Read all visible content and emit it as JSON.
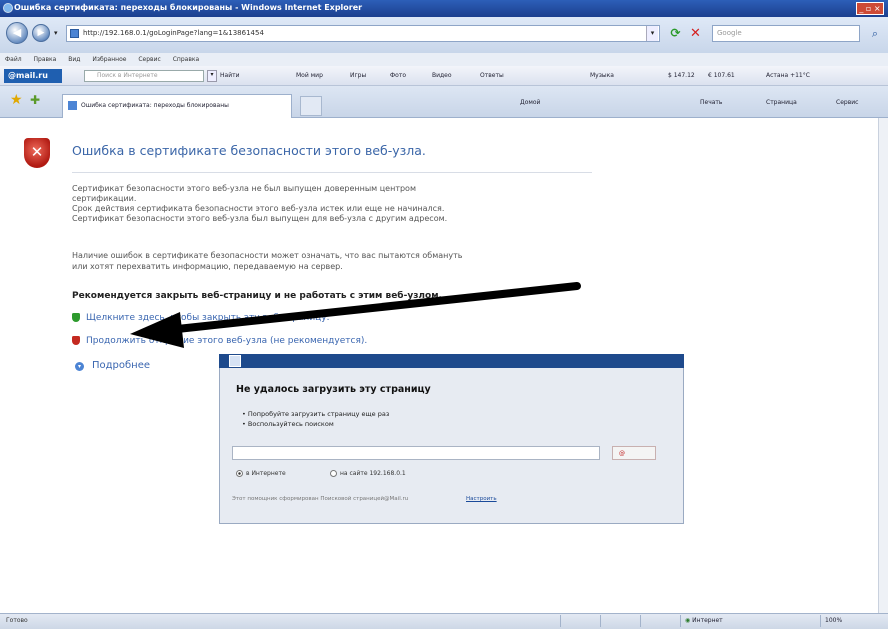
{
  "window": {
    "title": "Ошибка сертификата: переходы блокированы - Windows Internet Explorer",
    "controls": "_ ▫ ×"
  },
  "address_bar": {
    "url": "http://192.168.0.1/goLoginPage?lang=1&13861454",
    "search_placeholder": "Google",
    "back_icon": "back-arrow-icon",
    "forward_icon": "forward-arrow-icon"
  },
  "menu": {
    "items": [
      "Файл",
      "Правка",
      "Вид",
      "Избранное",
      "Сервис",
      "Справка"
    ]
  },
  "mail_toolbar": {
    "logo": "@mail.ru",
    "search_placeholder": "Поиск в Интернете",
    "items": [
      "Найти",
      "Мой мир",
      "Игры",
      "Фото",
      "Видео",
      "Ответы",
      "Музыка",
      "$ 147.12",
      "€ 107.61",
      "Астана +11°C"
    ]
  },
  "tabs": {
    "active_label": "Ошибка сертификата: переходы блокированы"
  },
  "command_bar": {
    "items": [
      "Домой",
      "Печать",
      "Страница",
      "Сервис"
    ]
  },
  "error_page": {
    "title": "Ошибка в сертификате безопасности этого веб-узла.",
    "paragraph1": [
      "Сертификат безопасности этого веб-узла не был выпущен доверенным центром",
      "сертификации.",
      "Срок действия сертификата безопасности этого веб-узла истек или еще не начинался.",
      "Сертификат безопасности этого веб-узла был выпущен для веб-узла с другим адресом."
    ],
    "paragraph2": [
      "Наличие ошибок в сертификате безопасности может означать, что вас пытаются обмануть",
      "или хотят перехватить информацию, передаваемую на сервер."
    ],
    "recommendation": "Рекомендуется закрыть веб-страницу и не работать с этим веб-узлом.",
    "link_close": "Щелкните здесь, чтобы закрыть эту веб-страницу.",
    "link_continue": "Продолжить открытие этого веб-узла (не рекомендуется).",
    "link_details": "Подробнее"
  },
  "overlay_dialog": {
    "title": "Не удалось загрузить эту страницу",
    "bullets": [
      "Попробуйте загрузить страницу еще раз",
      "Воспользуйтесь поиском"
    ],
    "search_button": "@",
    "radio_internet": "в Интернете",
    "radio_site": "на сайте 192.168.0.1",
    "footer_text": "Этот помощник сформирован Поисковой страницей@Mail.ru",
    "footer_link": "Настроить"
  },
  "status_bar": {
    "left": "Готово",
    "zone": "Интернет",
    "zoom": "100%"
  }
}
